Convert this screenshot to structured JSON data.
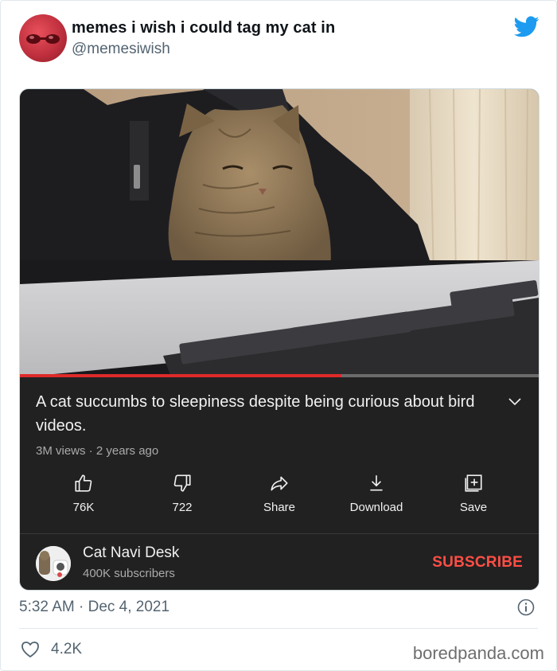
{
  "tweet": {
    "display_name": "memes i wish i could tag my cat in",
    "handle": "@memesiwish",
    "timestamp": "5:32 AM · Dec 4, 2021",
    "likes": "4.2K"
  },
  "video": {
    "title": "A cat succumbs to sleepiness despite being curious about bird videos.",
    "meta": "3M views · 2 years ago",
    "progress_fraction": 0.62,
    "actions": [
      {
        "icon": "thumbs-up-icon",
        "label": "76K"
      },
      {
        "icon": "thumbs-down-icon",
        "label": "722"
      },
      {
        "icon": "share-icon",
        "label": "Share"
      },
      {
        "icon": "download-icon",
        "label": "Download"
      },
      {
        "icon": "save-icon",
        "label": "Save"
      }
    ],
    "channel": {
      "name": "Cat Navi Desk",
      "subscribers": "400K subscribers",
      "subscribe_label": "SUBSCRIBE"
    }
  },
  "watermark": "boredpanda.com",
  "colors": {
    "twitter_blue": "#1d9bf0",
    "youtube_red": "#ff4e45",
    "youtube_bg": "#212121"
  }
}
